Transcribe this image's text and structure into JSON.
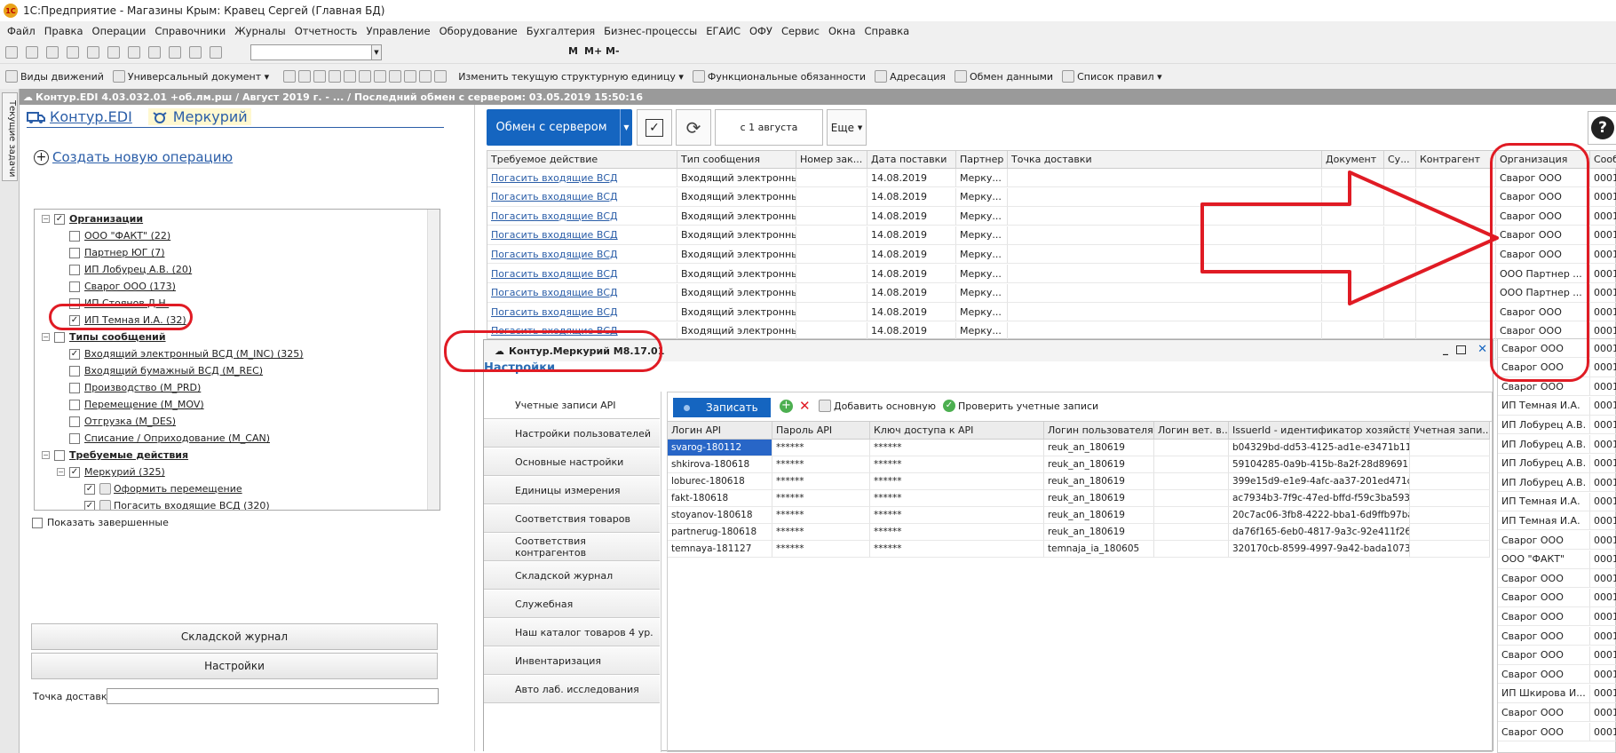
{
  "app": {
    "title": "1С:Предприятие - Магазины Крым: Кравец Сергей (Главная БД)"
  },
  "menu": [
    "Файл",
    "Правка",
    "Операции",
    "Справочники",
    "Журналы",
    "Отчетность",
    "Управление",
    "Оборудование",
    "Бухгалтерия",
    "Бизнес-процессы",
    "ЕГАИС",
    "ОФУ",
    "Сервис",
    "Окна",
    "Справка"
  ],
  "toolbar1": {
    "bold_m": "M",
    "m_plus": "M+",
    "m_minus": "M-"
  },
  "toolbar2": {
    "items": [
      "Виды движений",
      "Универсальный документ",
      "Изменить текущую структурную единицу",
      "Функциональные обязанности",
      "Адресация",
      "Обмен данными",
      "Список правил"
    ]
  },
  "sidebar": {
    "vertical_tab": "Текущие задачи"
  },
  "strip": {
    "text": "Контур.EDI 4.03.032.01 +об.лм.рш / Август 2019 г. - ... / Последний обмен с сервером: 03.05.2019 15:50:16"
  },
  "left": {
    "tab_edi": "Контур.EDI",
    "tab_mercury": "Меркурий",
    "create_op": "Создать новую операцию",
    "tree": [
      {
        "level": 0,
        "exp": "−",
        "checked": true,
        "bold": true,
        "label": "Организации"
      },
      {
        "level": 1,
        "checked": false,
        "label": "ООО \"ФАКТ\" (22)"
      },
      {
        "level": 1,
        "checked": false,
        "label": "Партнер ЮГ (7)"
      },
      {
        "level": 1,
        "checked": false,
        "label": "ИП Лобурец А.В. (20)"
      },
      {
        "level": 1,
        "checked": false,
        "label": "Сварог ООО (173)"
      },
      {
        "level": 1,
        "checked": false,
        "label": "ИП Стоянов Д.Н."
      },
      {
        "level": 1,
        "checked": true,
        "label": "ИП Темная И.А. (32)"
      },
      {
        "level": 0,
        "exp": "−",
        "checked": false,
        "bold": true,
        "label": "Типы сообщений"
      },
      {
        "level": 1,
        "checked": true,
        "label": "Входящий электронный ВСД (M_INC) (325)"
      },
      {
        "level": 1,
        "checked": false,
        "label": "Входящий бумажный ВСД (M_REC)"
      },
      {
        "level": 1,
        "checked": false,
        "label": "Производство (M_PRD)"
      },
      {
        "level": 1,
        "checked": false,
        "label": "Перемещение (M_MOV)"
      },
      {
        "level": 1,
        "checked": false,
        "label": "Отгрузка (M_DES)"
      },
      {
        "level": 1,
        "checked": false,
        "label": "Списание / Оприходование (M_CAN)"
      },
      {
        "level": 0,
        "exp": "−",
        "checked": false,
        "bold": true,
        "label": "Требуемые действия"
      },
      {
        "level": 1,
        "exp": "−",
        "checked": true,
        "label": "Меркурий (325)"
      },
      {
        "level": 2,
        "checked": true,
        "label": "Оформить перемещение"
      },
      {
        "level": 2,
        "checked": true,
        "label": "Погасить входящие ВСД (320)"
      }
    ],
    "show_completed": "Показать завершенные",
    "btn_journal": "Складской журнал",
    "btn_settings": "Настройки",
    "delivery_label": "Точка доставки:",
    "delivery_value": ""
  },
  "right": {
    "btn_exchange": "Обмен с сервером",
    "date_btn": "с 1 августа",
    "more": "Еще",
    "help": "?",
    "columns": [
      "Требуемое действие",
      "Тип сообщения",
      "Номер зак...",
      "Дата поставки",
      "Партнер",
      "Точка доставки",
      "Документ",
      "Су...",
      "Контрагент",
      "Организация",
      "Сооб"
    ],
    "rows": [
      [
        "Погасить входящие ВСД",
        "Входящий электронный ...",
        "",
        "14.08.2019",
        "Мерку...",
        "",
        "",
        "",
        "",
        "Сварог ООО",
        "0001"
      ],
      [
        "Погасить входящие ВСД",
        "Входящий электронный ...",
        "",
        "14.08.2019",
        "Мерку...",
        "",
        "",
        "",
        "",
        "Сварог ООО",
        "0001"
      ],
      [
        "Погасить входящие ВСД",
        "Входящий электронный ...",
        "",
        "14.08.2019",
        "Мерку...",
        "",
        "",
        "",
        "",
        "Сварог ООО",
        "0001"
      ],
      [
        "Погасить входящие ВСД",
        "Входящий электронный ...",
        "",
        "14.08.2019",
        "Мерку...",
        "",
        "",
        "",
        "",
        "Сварог ООО",
        "0001"
      ],
      [
        "Погасить входящие ВСД",
        "Входящий электронный ...",
        "",
        "14.08.2019",
        "Мерку...",
        "",
        "",
        "",
        "",
        "Сварог ООО",
        "0001"
      ],
      [
        "Погасить входящие ВСД",
        "Входящий электронный ...",
        "",
        "14.08.2019",
        "Мерку...",
        "",
        "",
        "",
        "",
        "ООО Партнер ...",
        "0001"
      ],
      [
        "Погасить входящие ВСД",
        "Входящий электронный ...",
        "",
        "14.08.2019",
        "Мерку...",
        "",
        "",
        "",
        "",
        "ООО Партнер ...",
        "0001"
      ],
      [
        "Погасить входящие ВСД",
        "Входящий электронный ...",
        "",
        "14.08.2019",
        "Мерку...",
        "",
        "",
        "",
        "",
        "Сварог ООО",
        "0001"
      ],
      [
        "Погасить входящие ВСД",
        "Входящий электронный ...",
        "",
        "14.08.2019",
        "Мерку...",
        "",
        "",
        "",
        "",
        "Сварог ООО",
        "0001"
      ],
      [
        "Погасить входящие ВСД",
        "",
        "",
        "",
        "",
        "",
        "",
        "",
        "",
        "Сварог ООО",
        "0001"
      ]
    ],
    "org_more": [
      "Сварог ООО",
      "Сварог ООО",
      "Сварог ООО",
      "ИП Темная И.А.",
      "ИП Лобурец А.В.",
      "ИП Лобурец А.В.",
      "ИП Лобурец А.В.",
      "ИП Лобурец А.В.",
      "ИП Темная И.А.",
      "ИП Темная И.А.",
      "Сварог ООО",
      "ООО \"ФАКТ\"",
      "Сварог ООО",
      "Сварог ООО",
      "Сварог ООО",
      "Сварог ООО",
      "Сварог ООО",
      "Сварог ООО",
      "ИП Шкирова И...",
      "Сварог ООО",
      "Сварог ООО"
    ],
    "org_code": "0001"
  },
  "dialog": {
    "title": "Контур.Меркурий M8.17.01",
    "section": "Настройки",
    "nav": [
      "Учетные записи API",
      "Настройки пользователей",
      "Основные настройки",
      "Единицы измерения",
      "Соответствия товаров",
      "Соответствия контрагентов",
      "Складской журнал",
      "Служебная",
      "Наш каталог товаров 4 ур.",
      "Инвентаризация",
      "Авто лаб. исследования"
    ],
    "btn_save": "Записать",
    "btn_add_main": "Добавить основную",
    "btn_check": "Проверить учетные записи",
    "columns": [
      "Логин API",
      "Пароль API",
      "Ключ доступа к API",
      "Логин пользователя...",
      "Логин вет. в...",
      "IssuerId - идентификатор хозяйствую...",
      "Учетная запи..."
    ],
    "rows": [
      [
        "svarog-180112",
        "******",
        "******",
        "reuk_an_180619",
        "",
        "b04329bd-dd53-4125-ad1e-e3471b11...",
        ""
      ],
      [
        "shkirova-180618",
        "******",
        "******",
        "reuk_an_180619",
        "",
        "59104285-0a9b-415b-8a2f-28d896911...",
        ""
      ],
      [
        "loburec-180618",
        "******",
        "******",
        "reuk_an_180619",
        "",
        "399e15d9-e1e9-4afc-aa37-201ed471c...",
        ""
      ],
      [
        "fakt-180618",
        "******",
        "******",
        "reuk_an_180619",
        "",
        "ac7934b3-7f9c-47ed-bffd-f59c3ba5938b",
        ""
      ],
      [
        "stoyanov-180618",
        "******",
        "******",
        "reuk_an_180619",
        "",
        "20c7ac06-3fb8-4222-bba1-6d9ffb97ba...",
        ""
      ],
      [
        "partnerug-180618",
        "******",
        "******",
        "reuk_an_180619",
        "",
        "da76f165-6eb0-4817-9a3c-92e411f26...",
        ""
      ],
      [
        "temnaya-181127",
        "******",
        "******",
        "temnaja_ia_180605",
        "",
        "320170cb-8599-4997-9a42-bada1073...",
        ""
      ]
    ]
  },
  "colors": {
    "accent_blue": "#1565c0",
    "annot_red": "#e01b24",
    "link": "#2b5ea8"
  }
}
